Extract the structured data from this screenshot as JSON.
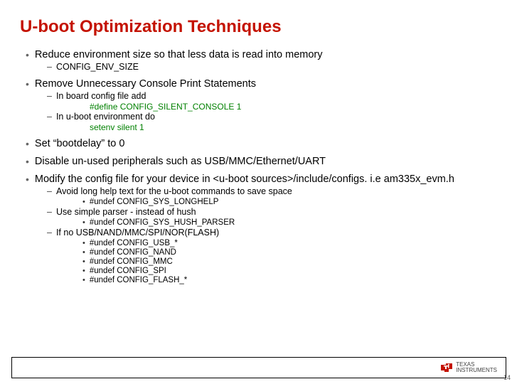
{
  "title": "U-boot Optimization Techniques",
  "bullets": [
    {
      "text": "Reduce environment size so that less data is read into memory",
      "sub": [
        {
          "text": "CONFIG_ENV_SIZE"
        }
      ]
    },
    {
      "text": "Remove Unnecessary Console Print Statements",
      "sub": [
        {
          "text": "In board config file add",
          "code": "#define CONFIG_SILENT_CONSOLE 1"
        },
        {
          "text": "In u-boot environment do",
          "code": "setenv silent 1"
        }
      ]
    },
    {
      "text": "Set “bootdelay” to 0"
    },
    {
      "text": "Disable un-used peripherals such as USB/MMC/Ethernet/UART"
    },
    {
      "text": "Modify the config file for your device in <u-boot sources>/include/configs. i.e am335x_evm.h",
      "sub": [
        {
          "text": "Avoid long help text for the u-boot commands to save space",
          "sub3": [
            {
              "text": "#undef CONFIG_SYS_LONGHELP"
            }
          ]
        },
        {
          "text": "Use simple parser - instead of hush",
          "sub3": [
            {
              "text": "#undef CONFIG_SYS_HUSH_PARSER"
            }
          ]
        },
        {
          "text": "If no USB/NAND/MMC/SPI/NOR(FLASH)",
          "sub3": [
            {
              "text": "#undef CONFIG_USB_*"
            },
            {
              "text": "#undef CONFIG_NAND"
            },
            {
              "text": "#undef CONFIG_MMC"
            },
            {
              "text": "#undef CONFIG_SPI"
            },
            {
              "text": "#undef CONFIG_FLASH_*"
            }
          ]
        }
      ]
    }
  ],
  "footer": {
    "logo_line1": "TEXAS",
    "logo_line2": "INSTRUMENTS"
  },
  "page_number": "14"
}
